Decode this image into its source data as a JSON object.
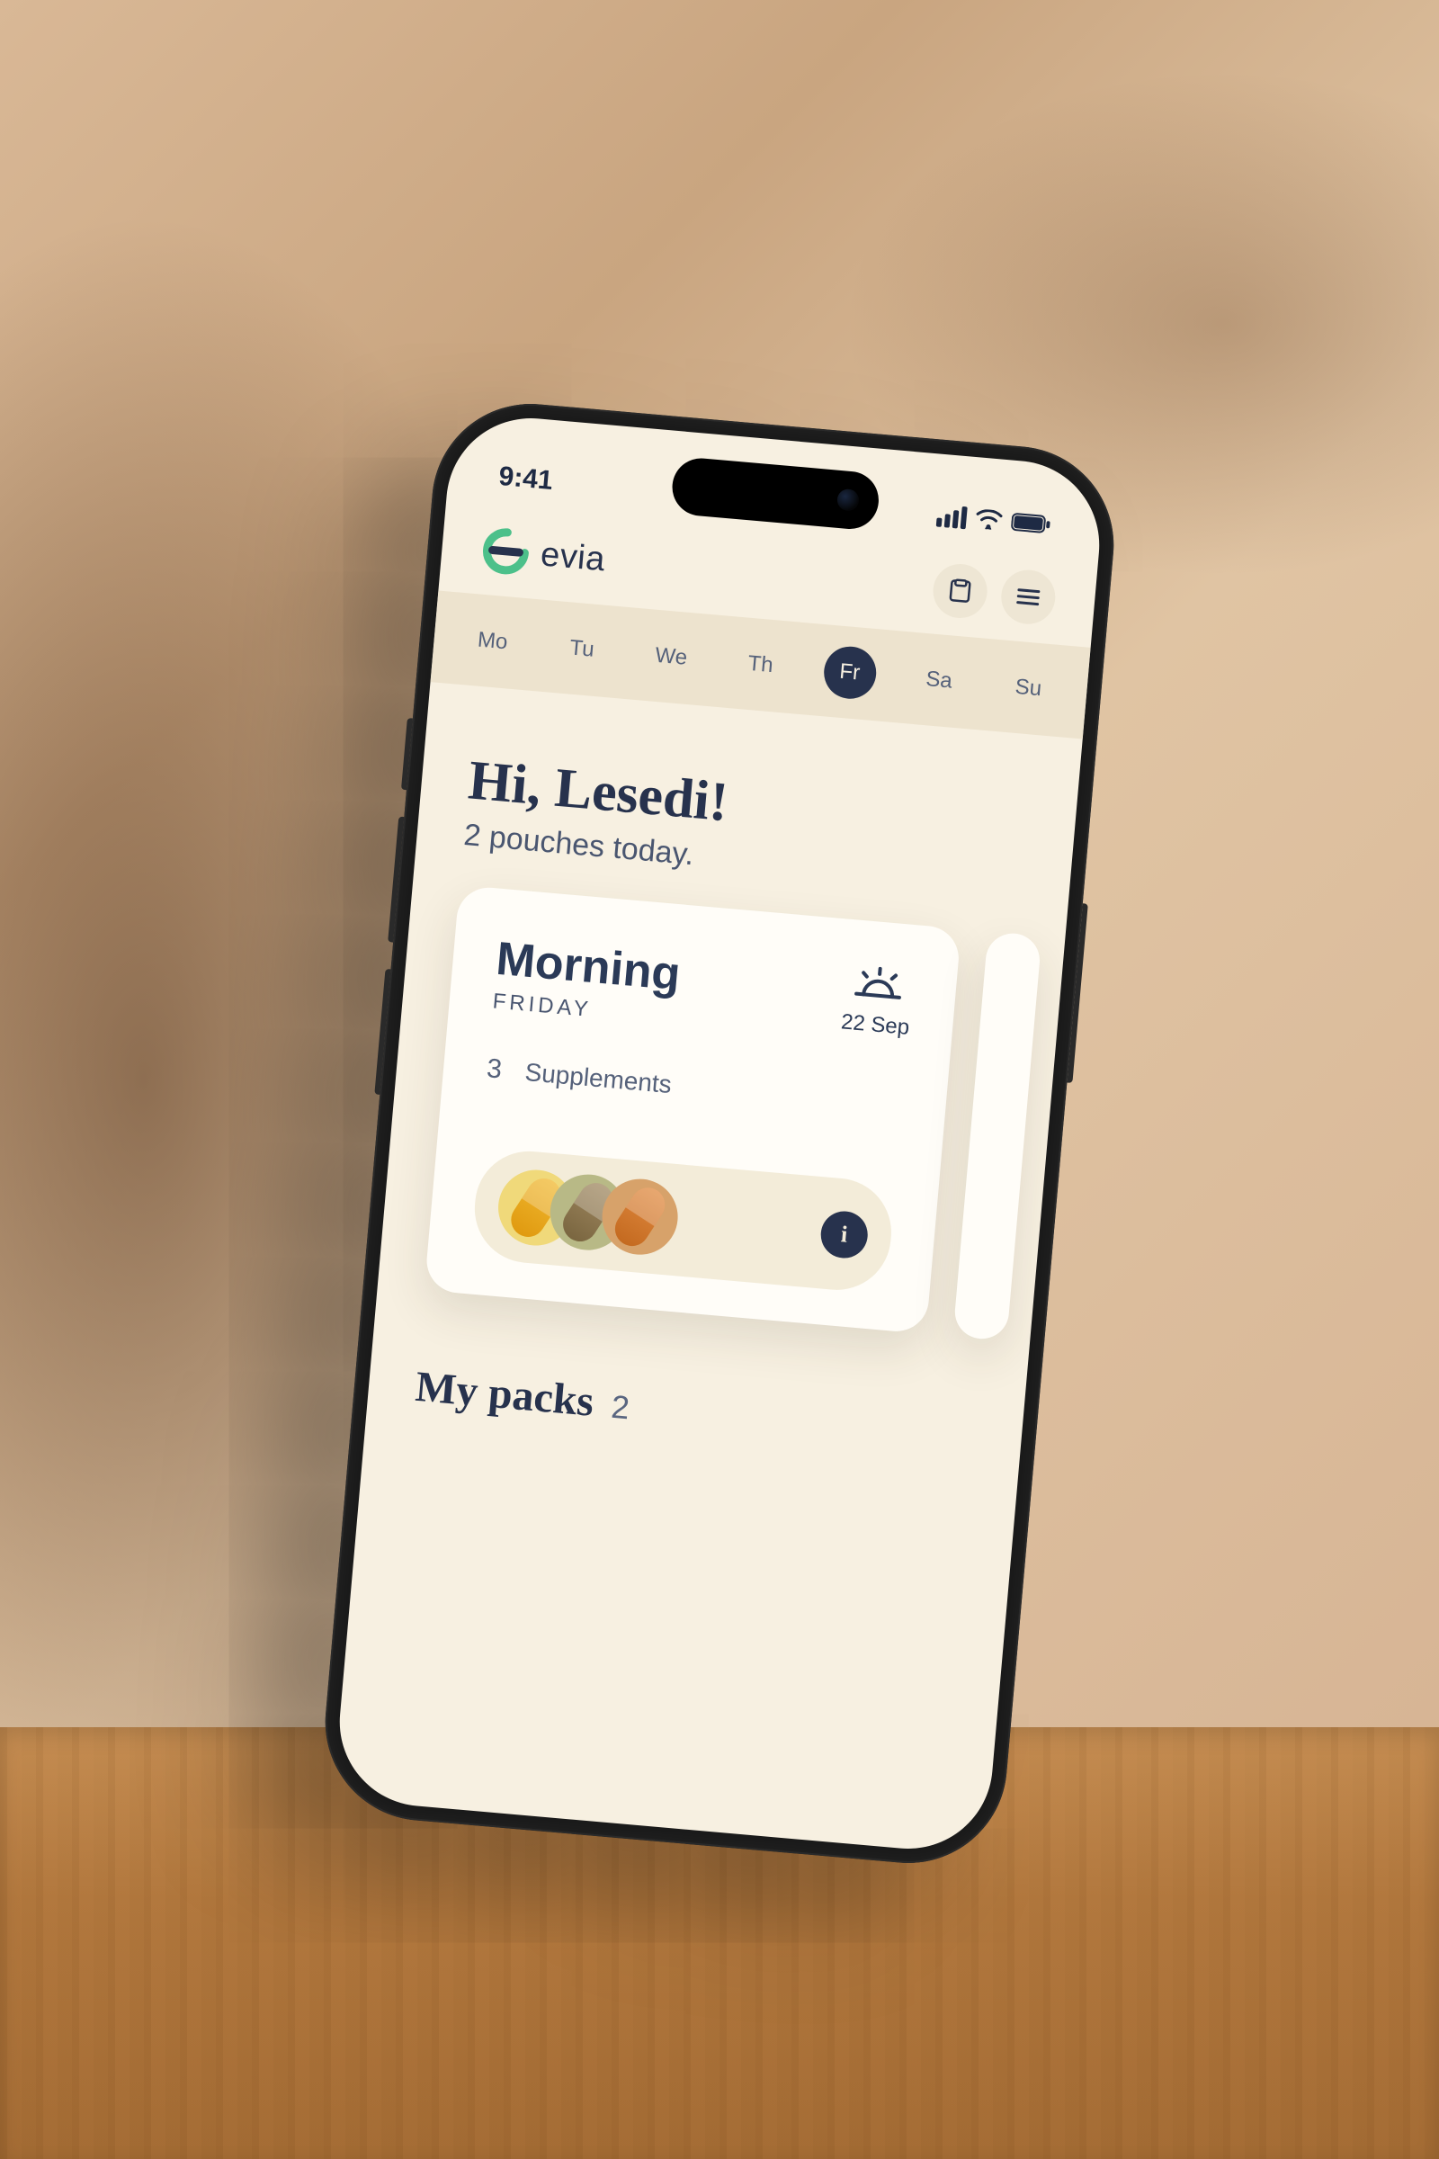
{
  "status": {
    "time": "9:41"
  },
  "brand": {
    "name": "evia",
    "accent": "#4cc08a",
    "ink": "#27324d"
  },
  "days": [
    {
      "abbr": "Mo",
      "active": false
    },
    {
      "abbr": "Tu",
      "active": false
    },
    {
      "abbr": "We",
      "active": false
    },
    {
      "abbr": "Th",
      "active": false
    },
    {
      "abbr": "Fr",
      "active": true
    },
    {
      "abbr": "Sa",
      "active": false
    },
    {
      "abbr": "Su",
      "active": false
    }
  ],
  "greeting": {
    "hi": "Hi, Lesedi!",
    "subtitle": "2 pouches today."
  },
  "pouch": {
    "slot": "Morning",
    "day": "FRIDAY",
    "date": "22 Sep",
    "supplement_count": "3",
    "supplement_label": "Supplements",
    "pills": [
      "yellow",
      "olive",
      "tan"
    ],
    "info_glyph": "i"
  },
  "packs": {
    "title": "My packs",
    "count": "2"
  }
}
